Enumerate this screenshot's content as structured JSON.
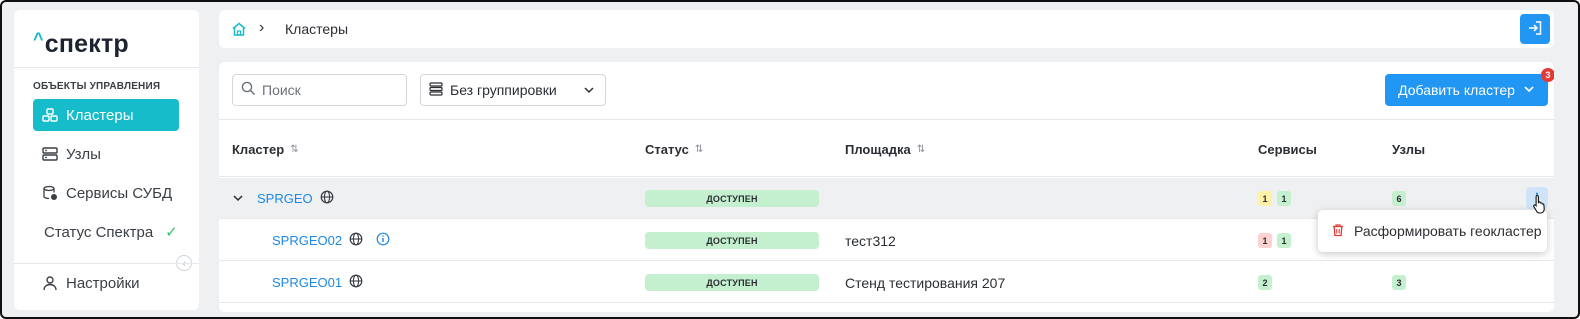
{
  "sidebar": {
    "logo": "спектр",
    "section_title": "ОБЪЕКТЫ УПРАВЛЕНИЯ",
    "items": [
      {
        "label": "Кластеры",
        "icon": "clusters-icon",
        "active": true
      },
      {
        "label": "Узлы",
        "icon": "nodes-icon",
        "active": false
      },
      {
        "label": "Сервисы СУБД",
        "icon": "db-services-icon",
        "active": false
      },
      {
        "label": "Статус Спектра",
        "icon": "check-icon",
        "active": false
      }
    ],
    "settings_label": "Настройки"
  },
  "header": {
    "breadcrumb": "Кластеры",
    "logout_icon": "logout-icon"
  },
  "toolbar": {
    "search_placeholder": "Поиск",
    "grouping_value": "Без группировки",
    "add_button_label": "Добавить кластер",
    "notification_count": "3"
  },
  "table": {
    "columns": [
      "Кластер",
      "Статус",
      "Площадка",
      "Сервисы",
      "Узлы"
    ],
    "rows": [
      {
        "name": "SPRGEO",
        "status": "ДОСТУПЕН",
        "site": "",
        "services": [
          "1",
          "1"
        ],
        "nodes": "6"
      },
      {
        "name": "SPRGEO02",
        "status": "ДОСТУПЕН",
        "site": "тест312",
        "services": [
          "1",
          "1"
        ],
        "nodes": ""
      },
      {
        "name": "SPRGEO01",
        "status": "ДОСТУПЕН",
        "site": "Стенд тестирования 207",
        "services": [
          "2"
        ],
        "nodes": "3"
      }
    ]
  },
  "context_menu": {
    "item_label": "Расформировать геокластер"
  },
  "colors": {
    "accent_teal": "#16bcc9",
    "primary_blue": "#2196f3",
    "status_green": "#c4f0cf",
    "badge_red": "#e53935"
  }
}
